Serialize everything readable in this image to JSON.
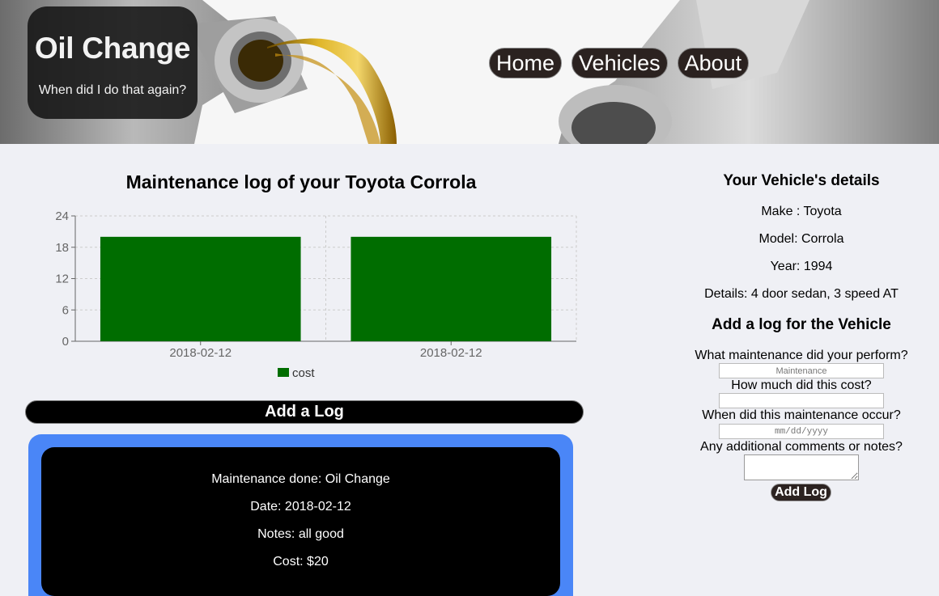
{
  "brand": {
    "title": "Oil Change",
    "subtitle": "When did I do that again?"
  },
  "nav": {
    "items": [
      "Home",
      "Vehicles",
      "About"
    ]
  },
  "main": {
    "heading": "Maintenance log of your Toyota Corrola",
    "add_log_label": "Add a Log",
    "entry": {
      "maintenance": "Maintenance done: Oil Change",
      "date": "Date: 2018-02-12",
      "notes": "Notes: all good",
      "cost": "Cost: $20"
    }
  },
  "chart_data": {
    "type": "bar",
    "categories": [
      "2018-02-12",
      "2018-02-12"
    ],
    "series": [
      {
        "name": "cost",
        "values": [
          20,
          20
        ],
        "color": "#006d00"
      }
    ],
    "ylim": [
      0,
      24
    ],
    "yticks": [
      0,
      6,
      12,
      18,
      24
    ],
    "grid": true,
    "legend": "bottom-center"
  },
  "sidebar": {
    "details_heading": "Your Vehicle's details",
    "make": "Make : Toyota",
    "model": "Model: Corrola",
    "year": "Year: 1994",
    "details": "Details: 4 door sedan, 3 speed AT",
    "form_heading": "Add a log for the Vehicle",
    "q_maintenance": "What maintenance did your perform?",
    "maintenance_placeholder": "Maintenance",
    "q_cost": "How much did this cost?",
    "q_date": "When did this maintenance occur?",
    "date_placeholder": "mm/dd/yyyy",
    "q_notes": "Any additional comments or notes?",
    "submit_label": "Add Log"
  },
  "colors": {
    "bar": "#006d00",
    "card_border": "#4a86f7",
    "nav_bg": "#2b2220"
  }
}
